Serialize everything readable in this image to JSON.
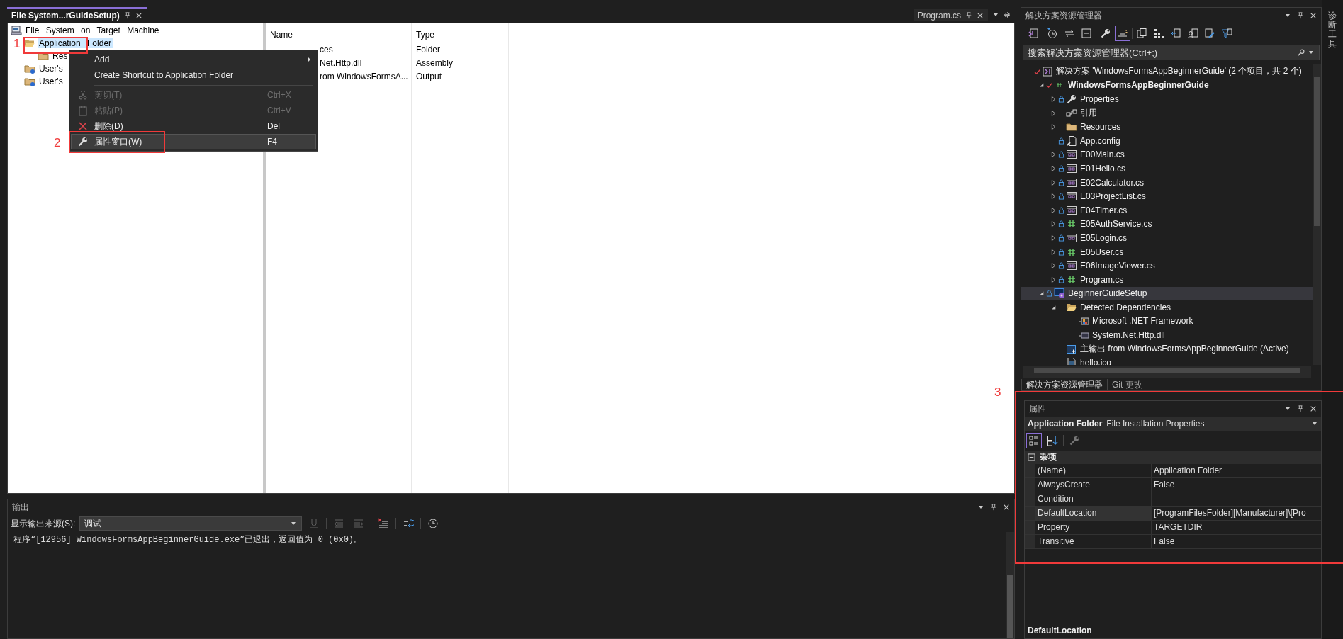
{
  "document_tabs": [
    {
      "label": "File System...rGuideSetup)",
      "selected": true
    },
    {
      "label": "Program.cs",
      "selected": false
    }
  ],
  "file_system": {
    "tree": [
      {
        "label": "File System on Target Machine",
        "kind": "computer",
        "selected": false,
        "children": [
          {
            "label": "Application Folder",
            "kind": "open-folder",
            "selected": true,
            "children": [
              {
                "label": "Res",
                "kind": "folder",
                "selected": false
              }
            ]
          },
          {
            "label": "User's",
            "kind": "special-folder",
            "selected": false
          },
          {
            "label": "User's",
            "kind": "special-folder",
            "selected": false
          }
        ]
      }
    ],
    "columns": [
      "Name",
      "Type"
    ],
    "rows": [
      {
        "name": "ces",
        "type": "Folder"
      },
      {
        "name": "Net.Http.dll",
        "type": "Assembly"
      },
      {
        "name": "rom WindowsFormsA...",
        "type": "Output"
      }
    ]
  },
  "context_menu": {
    "items": [
      {
        "kind": "submenu",
        "label": "Add",
        "disabled": false,
        "selected": false
      },
      {
        "kind": "command",
        "label": "Create Shortcut to Application Folder",
        "disabled": false,
        "selected": false
      },
      {
        "kind": "separator"
      },
      {
        "kind": "cut",
        "label": "剪切(T)",
        "shortcut": "Ctrl+X",
        "disabled": true,
        "selected": false
      },
      {
        "kind": "paste",
        "label": "粘贴(P)",
        "shortcut": "Ctrl+V",
        "disabled": true,
        "selected": false
      },
      {
        "kind": "delete",
        "label": "删除(D)",
        "shortcut": "Del",
        "disabled": false,
        "selected": false
      },
      {
        "kind": "properties",
        "label": "属性窗口(W)",
        "shortcut": "F4",
        "disabled": false,
        "selected": true
      }
    ]
  },
  "output": {
    "title": "输出",
    "source_label": "显示输出来源(S):",
    "source_value": "调试",
    "toolbar": [
      {
        "kind": "find",
        "disabled": true
      },
      {
        "kind": "separator"
      },
      {
        "kind": "outdent",
        "disabled": true
      },
      {
        "kind": "indent",
        "disabled": true
      },
      {
        "kind": "separator"
      },
      {
        "kind": "clear",
        "disabled": false
      },
      {
        "kind": "separator"
      },
      {
        "kind": "wrap",
        "disabled": false
      },
      {
        "kind": "separator"
      },
      {
        "kind": "clock",
        "disabled": false
      }
    ],
    "lines": [
      "程序“[12956] WindowsFormsAppBeginnerGuide.exe”已退出，返回值为 0 (0x0)。"
    ]
  },
  "solution_explorer": {
    "title": "解决方案资源管理器",
    "toolbar": [
      {
        "kind": "switch",
        "selected": false
      },
      {
        "kind": "separator"
      },
      {
        "kind": "history",
        "selected": false
      },
      {
        "kind": "sync",
        "selected": false
      },
      {
        "kind": "collapse",
        "selected": false
      },
      {
        "kind": "separator"
      },
      {
        "kind": "properties",
        "selected": false
      },
      {
        "kind": "show-all",
        "selected": true
      },
      {
        "kind": "separator"
      },
      {
        "kind": "copy",
        "selected": false
      },
      {
        "kind": "dots",
        "selected": false
      },
      {
        "kind": "pending",
        "selected": false
      },
      {
        "kind": "person",
        "selected": false
      },
      {
        "kind": "edit",
        "selected": false
      },
      {
        "kind": "filter",
        "selected": false
      }
    ],
    "search": {
      "placeholder": "搜索解决方案资源管理器(Ctrl+;)"
    },
    "items": [
      {
        "label": "解决方案 'WindowsFormsAppBeginnerGuide' (2 个项目，共 2 个)",
        "kind": "solution",
        "checked": true,
        "locked": false,
        "selected": false,
        "children": [
          {
            "label": "WindowsFormsAppBeginnerGuide",
            "kind": "startup-project",
            "expanded": true,
            "checked": true,
            "locked": false,
            "selected": false,
            "children": [
              {
                "label": "Properties",
                "kind": "properties",
                "expanded": false,
                "checked": false,
                "locked": true,
                "selected": false
              },
              {
                "label": "引用",
                "kind": "references",
                "expanded": false,
                "checked": false,
                "locked": false,
                "selected": false
              },
              {
                "label": "Resources",
                "kind": "folder",
                "expanded": false,
                "checked": false,
                "locked": false,
                "selected": false
              },
              {
                "label": "App.config",
                "kind": "config",
                "checked": false,
                "locked": true,
                "selected": false
              },
              {
                "label": "E00Main.cs",
                "kind": "form",
                "expanded": false,
                "checked": false,
                "locked": true,
                "selected": false
              },
              {
                "label": "E01Hello.cs",
                "kind": "form",
                "expanded": false,
                "checked": false,
                "locked": true,
                "selected": false
              },
              {
                "label": "E02Calculator.cs",
                "kind": "form",
                "expanded": false,
                "checked": false,
                "locked": true,
                "selected": false
              },
              {
                "label": "E03ProjectList.cs",
                "kind": "form",
                "expanded": false,
                "checked": false,
                "locked": true,
                "selected": false
              },
              {
                "label": "E04Timer.cs",
                "kind": "form",
                "expanded": false,
                "checked": false,
                "locked": true,
                "selected": false
              },
              {
                "label": "E05AuthService.cs",
                "kind": "class",
                "expanded": false,
                "checked": false,
                "locked": true,
                "selected": false
              },
              {
                "label": "E05Login.cs",
                "kind": "form",
                "expanded": false,
                "checked": false,
                "locked": true,
                "selected": false
              },
              {
                "label": "E05User.cs",
                "kind": "class",
                "expanded": false,
                "checked": false,
                "locked": true,
                "selected": false
              },
              {
                "label": "E06ImageViewer.cs",
                "kind": "form",
                "expanded": false,
                "checked": false,
                "locked": true,
                "selected": false
              },
              {
                "label": "Program.cs",
                "kind": "class",
                "expanded": false,
                "checked": false,
                "locked": true,
                "selected": false
              }
            ]
          },
          {
            "label": "BeginnerGuideSetup",
            "kind": "setup-project",
            "expanded": true,
            "checked": false,
            "locked": true,
            "selected": true,
            "children": [
              {
                "label": "Detected Dependencies",
                "kind": "open-folder",
                "expanded": true,
                "checked": false,
                "locked": false,
                "selected": false,
                "children": [
                  {
                    "label": "Microsoft .NET Framework",
                    "kind": "framework",
                    "checked": false,
                    "locked": false,
                    "selected": false
                  },
                  {
                    "label": "System.Net.Http.dll",
                    "kind": "assembly",
                    "checked": false,
                    "locked": false,
                    "selected": false
                  }
                ]
              },
              {
                "label": "主输出 from WindowsFormsAppBeginnerGuide (Active)",
                "kind": "output",
                "checked": false,
                "locked": false,
                "selected": false
              },
              {
                "label": "hello.ico",
                "kind": "file",
                "checked": false,
                "locked": false,
                "selected": false
              }
            ]
          }
        ]
      }
    ],
    "tabs": [
      {
        "label": "解决方案资源管理器",
        "selected": true
      },
      {
        "label": "Git 更改",
        "selected": false
      }
    ]
  },
  "properties": {
    "title": "属性",
    "object_name": "Application Folder",
    "object_type": "File Installation Properties",
    "toolbar": [
      {
        "kind": "categorized",
        "selected": true
      },
      {
        "kind": "alphabetical",
        "selected": false
      },
      {
        "kind": "separator"
      },
      {
        "kind": "pages",
        "selected": false
      }
    ],
    "category": {
      "label": "杂项",
      "expanded": true
    },
    "rows": [
      {
        "name": "(Name)",
        "value": "Application Folder",
        "selected": false
      },
      {
        "name": "AlwaysCreate",
        "value": "False",
        "selected": false
      },
      {
        "name": "Condition",
        "selected": false
      },
      {
        "name": "DefaultLocation",
        "value": "[ProgramFilesFolder][Manufacturer]\\[Pro",
        "selected": true
      },
      {
        "name": "Property",
        "value": "TARGETDIR",
        "selected": false
      },
      {
        "name": "Transitive",
        "value": "False",
        "selected": false
      }
    ],
    "description_title": "DefaultLocation"
  },
  "side_tab": "诊断工具",
  "annotations": [
    {
      "label": "1"
    },
    {
      "label": "2"
    },
    {
      "label": "3"
    }
  ]
}
